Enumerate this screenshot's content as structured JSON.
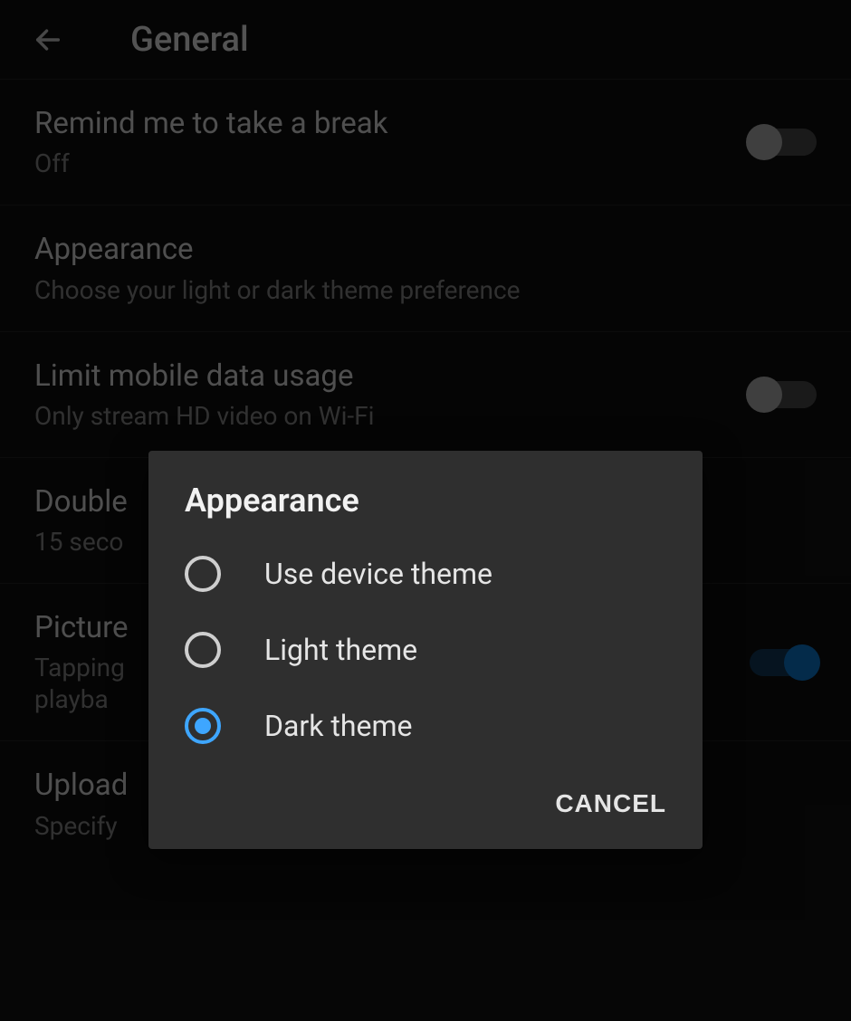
{
  "header": {
    "title": "General"
  },
  "rows": {
    "break": {
      "title": "Remind me to take a break",
      "sub": "Off"
    },
    "appearance": {
      "title": "Appearance",
      "sub": "Choose your light or dark theme preference"
    },
    "data": {
      "title": "Limit mobile data usage",
      "sub": "Only stream HD video on Wi-Fi"
    },
    "double": {
      "title": "Double",
      "sub": "15 seco"
    },
    "pip": {
      "title": "Picture",
      "sub": "Tapping\nplayba"
    },
    "upload": {
      "title": "Upload",
      "sub": "Specify"
    }
  },
  "dialog": {
    "title": "Appearance",
    "options": {
      "device": "Use device theme",
      "light": "Light theme",
      "dark": "Dark theme"
    },
    "selected": "dark",
    "cancel": "CANCEL"
  }
}
